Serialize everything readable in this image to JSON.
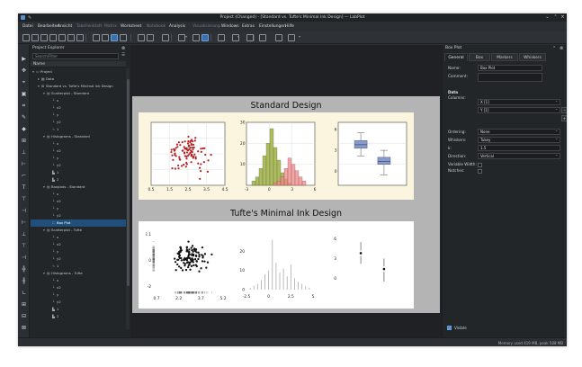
{
  "window": {
    "title": "Project (Changed) - [Standard vs. Tufte's Minimal Ink Design] — LabPlot"
  },
  "menu": [
    {
      "label": "Datei",
      "enabled": true
    },
    {
      "label": "Bearbeiten",
      "enabled": true
    },
    {
      "label": "Ansicht",
      "enabled": true
    },
    {
      "label": "Tabellenblatt",
      "enabled": false
    },
    {
      "label": "Matrix",
      "enabled": false
    },
    {
      "label": "Worksheet",
      "enabled": true
    },
    {
      "label": "Notebook",
      "enabled": false
    },
    {
      "label": "Analysis",
      "enabled": true
    },
    {
      "label": "Visualisierung",
      "enabled": false
    },
    {
      "label": "Windows",
      "enabled": true
    },
    {
      "label": "Extras",
      "enabled": true
    },
    {
      "label": "Einstellungen",
      "enabled": true
    },
    {
      "label": "Hilfe",
      "enabled": true
    }
  ],
  "explorer": {
    "title": "Project Explorer",
    "search_placeholder": "Search/Filter",
    "name_header": "Name",
    "items": [
      {
        "label": "Project",
        "depth": 0,
        "icon": "folder-icon",
        "chev": "▾"
      },
      {
        "label": "Data",
        "depth": 1,
        "icon": "table-icon",
        "chev": "▸"
      },
      {
        "label": "Standard vs. Tufte's Minimal Ink Design",
        "depth": 1,
        "icon": "worksheet-icon",
        "chev": "▾"
      },
      {
        "label": "Scatterplot - Standard",
        "depth": 2,
        "icon": "plot-icon",
        "chev": "▾"
      },
      {
        "label": "x",
        "depth": 3,
        "icon": "axis-icon",
        "chev": ""
      },
      {
        "label": "x2",
        "depth": 3,
        "icon": "axis-icon",
        "chev": ""
      },
      {
        "label": "y",
        "depth": 3,
        "icon": "axis-icon",
        "chev": ""
      },
      {
        "label": "y2",
        "depth": 3,
        "icon": "axis-icon",
        "chev": ""
      },
      {
        "label": "1",
        "depth": 3,
        "icon": "curve-icon",
        "chev": ""
      },
      {
        "label": "Histograms - Standard",
        "depth": 2,
        "icon": "plot-icon",
        "chev": "▾"
      },
      {
        "label": "x",
        "depth": 3,
        "icon": "axis-icon",
        "chev": ""
      },
      {
        "label": "x2",
        "depth": 3,
        "icon": "axis-icon",
        "chev": ""
      },
      {
        "label": "y",
        "depth": 3,
        "icon": "axis-icon",
        "chev": ""
      },
      {
        "label": "y2",
        "depth": 3,
        "icon": "axis-icon",
        "chev": ""
      },
      {
        "label": "1",
        "depth": 3,
        "icon": "histogram-icon",
        "chev": ""
      },
      {
        "label": "2",
        "depth": 3,
        "icon": "histogram-icon",
        "chev": ""
      },
      {
        "label": "Boxplots - Standard",
        "depth": 2,
        "icon": "plot-icon",
        "chev": "▾"
      },
      {
        "label": "x",
        "depth": 3,
        "icon": "axis-icon",
        "chev": ""
      },
      {
        "label": "x2",
        "depth": 3,
        "icon": "axis-icon",
        "chev": ""
      },
      {
        "label": "y",
        "depth": 3,
        "icon": "axis-icon",
        "chev": ""
      },
      {
        "label": "y2",
        "depth": 3,
        "icon": "axis-icon",
        "chev": ""
      },
      {
        "label": "Box Plot",
        "depth": 3,
        "icon": "boxplot-icon",
        "chev": "",
        "selected": true
      },
      {
        "label": "Scatterplot - Tufte",
        "depth": 2,
        "icon": "plot-icon",
        "chev": "▾"
      },
      {
        "label": "x",
        "depth": 3,
        "icon": "axis-icon",
        "chev": ""
      },
      {
        "label": "x2",
        "depth": 3,
        "icon": "axis-icon",
        "chev": ""
      },
      {
        "label": "y",
        "depth": 3,
        "icon": "axis-icon",
        "chev": ""
      },
      {
        "label": "y2",
        "depth": 3,
        "icon": "axis-icon",
        "chev": ""
      },
      {
        "label": "1",
        "depth": 3,
        "icon": "curve-icon",
        "chev": ""
      },
      {
        "label": "Histograms - Tufte",
        "depth": 2,
        "icon": "plot-icon",
        "chev": "▾"
      },
      {
        "label": "x",
        "depth": 3,
        "icon": "axis-icon",
        "chev": ""
      },
      {
        "label": "x2",
        "depth": 3,
        "icon": "axis-icon",
        "chev": ""
      },
      {
        "label": "y",
        "depth": 3,
        "icon": "axis-icon",
        "chev": ""
      },
      {
        "label": "y2",
        "depth": 3,
        "icon": "axis-icon",
        "chev": ""
      },
      {
        "label": "1",
        "depth": 3,
        "icon": "histogram-icon",
        "chev": ""
      },
      {
        "label": "2",
        "depth": 3,
        "icon": "histogram-icon",
        "chev": ""
      }
    ]
  },
  "worksheet": {
    "section1_title": "Standard Design",
    "section2_title": "Tufte's Minimal Ink Design"
  },
  "chart_data": [
    {
      "type": "scatter",
      "xticks": [
        "0.5",
        "1.5",
        "2.5",
        "3.5",
        "4.5"
      ],
      "xlim": [
        0.5,
        4.5
      ],
      "ylim": [
        0,
        4
      ],
      "grid": true,
      "color": "#b22222"
    },
    {
      "type": "bar",
      "xticks": [
        "-3",
        "0",
        "3",
        "6"
      ],
      "yticks": [
        "30",
        "20",
        "10"
      ],
      "ylim": [
        0,
        30
      ],
      "grid": true,
      "series": [
        {
          "color": "#9aaa3a",
          "values": [
            2,
            4,
            8,
            14,
            20,
            27,
            18,
            12,
            6,
            3,
            1
          ]
        },
        {
          "color": "#e88a8a",
          "values": [
            1,
            2,
            4,
            8,
            13,
            10,
            7,
            4,
            2
          ]
        }
      ]
    },
    {
      "type": "bar",
      "yticks": [
        "6",
        "3",
        "0"
      ],
      "ylim": [
        -2,
        7
      ],
      "grid": true,
      "boxes": [
        {
          "q1": 3.3,
          "median": 3.8,
          "q3": 4.4,
          "wlow": 2.2,
          "whigh": 5.5,
          "color": "#8a9bc9"
        },
        {
          "q1": 1.0,
          "median": 1.4,
          "q3": 2.0,
          "wlow": -0.5,
          "whigh": 3.0,
          "color": "#8a9bc9"
        }
      ]
    },
    {
      "type": "scatter",
      "xticks": [
        "0.7",
        "2.2",
        "3.7",
        "5.2"
      ],
      "yticks": [
        "2.1",
        "0",
        "-2"
      ],
      "xlim": [
        0.7,
        5.2
      ],
      "ylim": [
        -2.5,
        2.5
      ],
      "grid": false,
      "color": "#111111"
    },
    {
      "type": "bar",
      "xticks": [
        "-2.5",
        "0",
        "2.5",
        "5"
      ],
      "yticks": [
        "20",
        "10",
        "0"
      ],
      "ylim": [
        0,
        30
      ],
      "grid": false,
      "values": [
        1,
        2,
        3,
        5,
        8,
        10,
        26,
        14,
        9,
        11,
        7,
        13,
        6,
        4,
        3,
        2,
        1
      ]
    },
    {
      "type": "bar",
      "yticks": [
        "6",
        "3",
        "0"
      ],
      "ylim": [
        -2,
        7
      ],
      "grid": false,
      "boxes": [
        {
          "median": 3.8,
          "wlow": 2.2,
          "whigh": 5.5
        },
        {
          "median": 1.4,
          "wlow": -0.5,
          "whigh": 3.0
        }
      ]
    }
  ],
  "props": {
    "title": "Box Plot",
    "tabs": [
      "General",
      "Box",
      "Markers",
      "Whiskers"
    ],
    "name_label": "Name:",
    "name_value": "Box Plot",
    "comment_label": "Comment:",
    "data_label": "Data",
    "columns_label": "Columns:",
    "columns": [
      "X [1]",
      "Y [1]"
    ],
    "ordering_label": "Ordering:",
    "ordering_value": "None",
    "whiskers_label": "Whiskers:",
    "whiskers_value": "Tukey",
    "k_label": "k:",
    "k_value": "1.5",
    "direction_label": "Direction:",
    "direction_value": "Vertical",
    "variable_width_label": "Variable Width:",
    "notches_label": "Notches:",
    "visible_label": "Visible"
  },
  "status": {
    "text": "Memory used 419 MB, peak 508 MB"
  }
}
